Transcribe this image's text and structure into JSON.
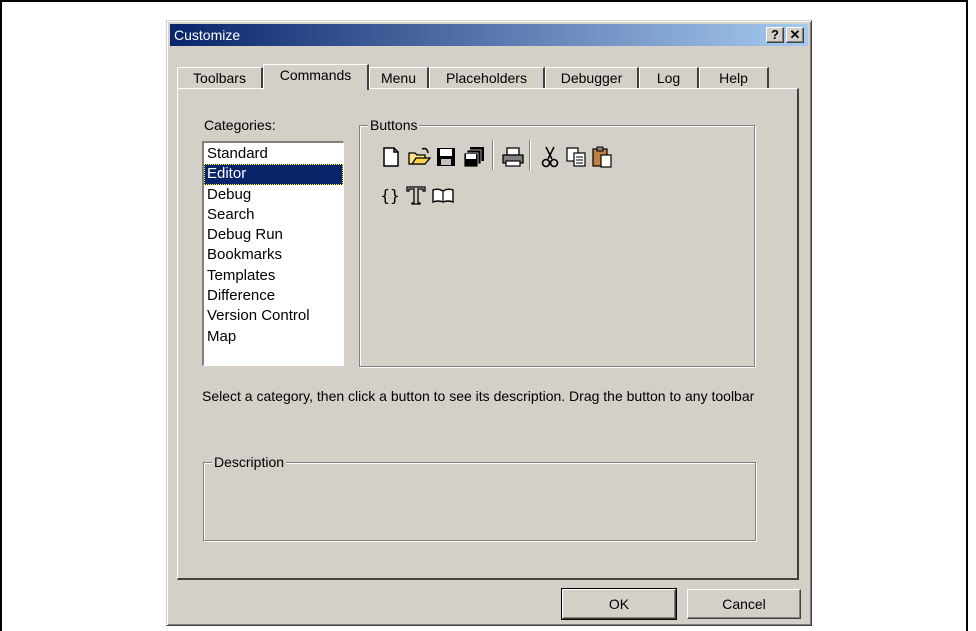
{
  "dialog": {
    "title": "Customize",
    "help_glyph": "?",
    "close_glyph": "✕"
  },
  "tabs": [
    {
      "label": "Toolbars"
    },
    {
      "label": "Commands"
    },
    {
      "label": "Menu"
    },
    {
      "label": "Placeholders"
    },
    {
      "label": "Debugger"
    },
    {
      "label": "Log"
    },
    {
      "label": "Help"
    }
  ],
  "active_tab": "Commands",
  "categories": {
    "label": "Categories:",
    "items": [
      "Standard",
      "Editor",
      "Debug",
      "Search",
      "Debug Run",
      "Bookmarks",
      "Templates",
      "Difference",
      "Version Control",
      "Map"
    ],
    "selected": "Editor"
  },
  "buttons_group": {
    "caption": "Buttons",
    "icons_row1": [
      "new-file-icon",
      "open-folder-icon",
      "save-icon",
      "save-all-icon",
      "print-icon",
      "cut-icon",
      "copy-icon",
      "paste-icon"
    ],
    "icons_row2": [
      "braces-icon",
      "text-tool-icon",
      "book-icon"
    ]
  },
  "instructions": "Select a category, then click a button to see its description. Drag the button to any toolbar",
  "description": {
    "caption": "Description",
    "text": ""
  },
  "footer": {
    "ok_label": "OK",
    "cancel_label": "Cancel"
  },
  "colors": {
    "face": "#d4d0c8",
    "title_start": "#0a246a",
    "title_end": "#a6caf0",
    "selection": "#0a246a"
  }
}
